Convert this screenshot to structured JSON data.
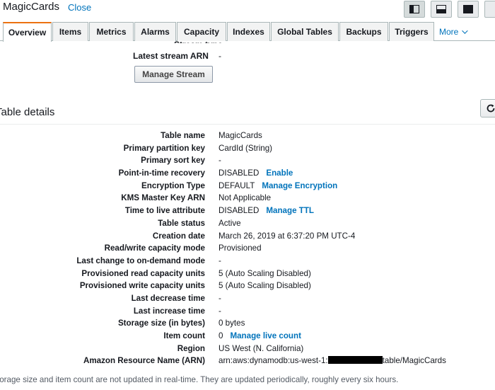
{
  "header": {
    "title": "MagicCards",
    "close_label": "Close"
  },
  "tabs": [
    {
      "label": "Overview",
      "active": true
    },
    {
      "label": "Items"
    },
    {
      "label": "Metrics"
    },
    {
      "label": "Alarms"
    },
    {
      "label": "Capacity"
    },
    {
      "label": "Indexes"
    },
    {
      "label": "Global Tables"
    },
    {
      "label": "Backups"
    },
    {
      "label": "Triggers"
    },
    {
      "label": "More"
    }
  ],
  "stream": {
    "partial_label": "Stream type",
    "arn_label": "Latest stream ARN",
    "arn_value": "-",
    "manage_button": "Manage Stream"
  },
  "section": {
    "title": "Table details"
  },
  "details": [
    {
      "label": "Table name",
      "value": "MagicCards"
    },
    {
      "label": "Primary partition key",
      "value": "CardId (String)"
    },
    {
      "label": "Primary sort key",
      "value": "-"
    },
    {
      "label": "Point-in-time recovery",
      "value": "DISABLED",
      "action": "Enable"
    },
    {
      "label": "Encryption Type",
      "value": "DEFAULT",
      "action": "Manage Encryption"
    },
    {
      "label": "KMS Master Key ARN",
      "value": "Not Applicable"
    },
    {
      "label": "Time to live attribute",
      "value": "DISABLED",
      "action": "Manage TTL"
    },
    {
      "label": "Table status",
      "value": "Active"
    },
    {
      "label": "Creation date",
      "value": "March 26, 2019 at 6:37:20 PM UTC-4"
    },
    {
      "label": "Read/write capacity mode",
      "value": "Provisioned"
    },
    {
      "label": "Last change to on-demand mode",
      "value": "-"
    },
    {
      "label": "Provisioned read capacity units",
      "value": "5 (Auto Scaling Disabled)"
    },
    {
      "label": "Provisioned write capacity units",
      "value": "5 (Auto Scaling Disabled)"
    },
    {
      "label": "Last decrease time",
      "value": "-"
    },
    {
      "label": "Last increase time",
      "value": "-"
    },
    {
      "label": "Storage size (in bytes)",
      "value": "0 bytes"
    },
    {
      "label": "Item count",
      "value": "0",
      "action": "Manage live count"
    },
    {
      "label": "Region",
      "value": "US West (N. California)"
    },
    {
      "label": "Amazon Resource Name (ARN)",
      "value": "arn:aws:dynamodb:us-west-1:",
      "value_suffix": "table/MagicCards",
      "redacted": true
    }
  ],
  "footnote": "torage size and item count are not updated in real-time. They are updated periodically, roughly every six hours."
}
